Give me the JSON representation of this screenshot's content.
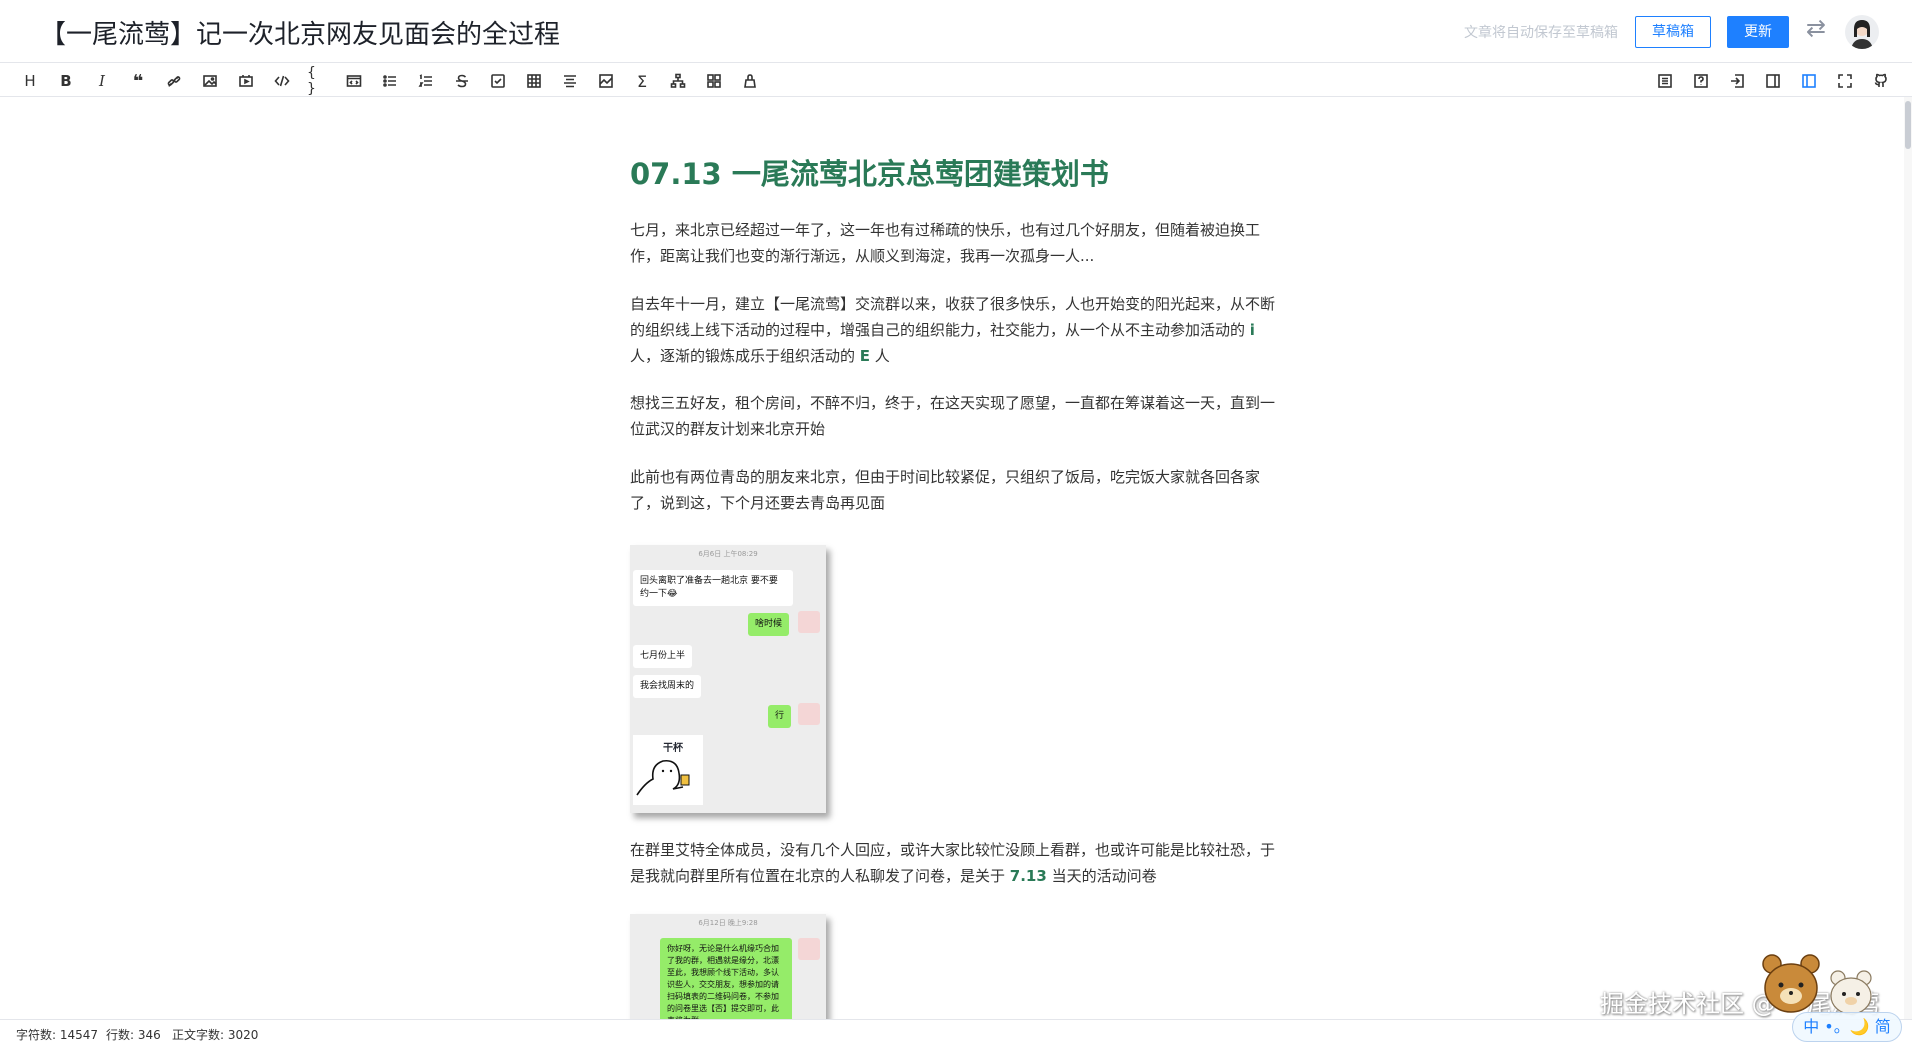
{
  "header": {
    "title": "【一尾流莺】记一次北京网友见面会的全过程",
    "autosave_text": "文章将自动保存至草稿箱",
    "draft_button": "草稿箱",
    "update_button": "更新"
  },
  "toolbar": {
    "left_icons": [
      "heading-icon",
      "bold-icon",
      "italic-icon",
      "quote-icon",
      "link-icon",
      "image-icon",
      "video-icon",
      "code-icon",
      "code-block-icon",
      "comment-icon",
      "unordered-list-icon",
      "ordered-list-icon",
      "strikethrough-icon",
      "task-list-icon",
      "table-icon",
      "align-center-icon",
      "image-upload-icon",
      "formula-icon",
      "diagram-icon",
      "grid-icon",
      "theme-icon"
    ],
    "right_icons": [
      "contents-icon",
      "help-icon",
      "insert-icon",
      "preview-only-icon",
      "split-view-icon",
      "fullscreen-icon",
      "github-icon"
    ]
  },
  "article": {
    "title": "07.13 一尾流莺北京总莺团建策划书",
    "p1": "七月，来北京已经超过一年了，这一年也有过稀疏的快乐，也有过几个好朋友，但随着被迫换工作，距离让我们也变的渐行渐远，从顺义到海淀，我再一次孤身一人...",
    "p2_a": "自去年十一月，建立【一尾流莺】交流群以来，收获了很多快乐，人也开始变的阳光起来，从不断的组织线上线下活动的过程中，增强自己的组织能力，社交能力，从一个从不主动参加活动的 ",
    "p2_i": "i",
    "p2_b": " 人，逐渐的锻炼成乐于组织活动的 ",
    "p2_e": "E",
    "p2_c": " 人",
    "p3": "想找三五好友，租个房间，不醉不归，终于，在这天实现了愿望，一直都在筹谋着这一天，直到一位武汉的群友计划来北京开始",
    "p4": "此前也有两位青岛的朋友来北京，但由于时间比较紧促，只组织了饭局，吃完饭大家就各回各家了，说到这，下个月还要去青岛再见面",
    "p5_a": "在群里艾特全体成员，没有几个人回应，或许大家比较忙没顾上看群，也或许可能是比较社恐，于是我就向群里所有位置在北京的人私聊发了问卷，是关于 ",
    "p5_date": "7.13",
    "p5_b": " 当天的活动问卷"
  },
  "chat1": {
    "timestamp": "6月6日 上午08:29",
    "msg1": "回头离职了准备去一趟北京 要不要约一下😂",
    "msg2": "啥时候",
    "msg3": "七月份上半",
    "msg4": "我会找周末的",
    "msg5": "行",
    "sticker_text": "干杯"
  },
  "chat2": {
    "timestamp": "6月12日 晚上9:28",
    "msg1": "你好呀，无论是什么机缘巧合加了我的群，相遇就是缘分，北漂至此，我想顾个线下活动，多认识些人，交交朋友，想参加的请扫码填表的二维码问卷，不参加的问卷里选【否】提交即可，此表将为群"
  },
  "footer": {
    "char_count": "字符数: 14547",
    "line_count": "行数: 346",
    "text_count": "正文字数: 3020"
  },
  "watermark": "掘金技术社区 @ 一尾流莺",
  "ime": "中 •。🌙 简"
}
